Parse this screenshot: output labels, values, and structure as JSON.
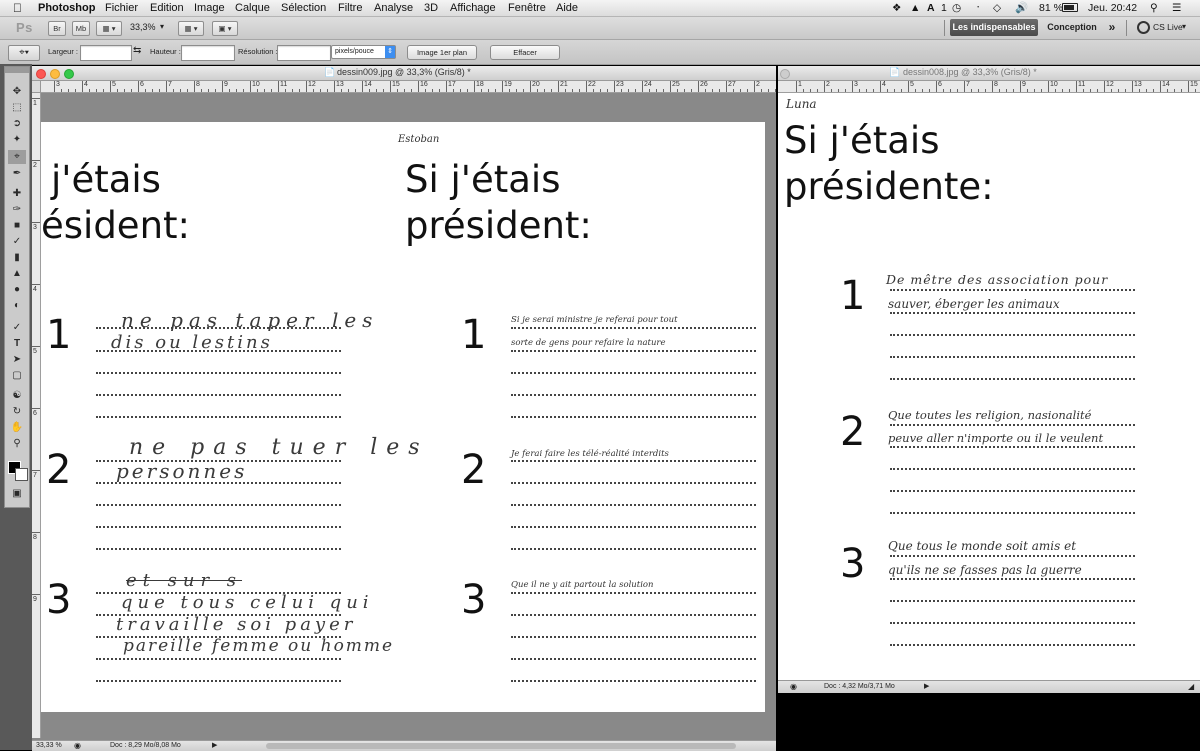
{
  "menubar": {
    "apple": "",
    "app_name": "Photoshop",
    "items": [
      "Fichier",
      "Edition",
      "Image",
      "Calque",
      "Sélection",
      "Filtre",
      "Analyse",
      "3D",
      "Affichage",
      "Fenêtre",
      "Aide"
    ],
    "status_icons": [
      "dropbox-icon",
      "drive-icon",
      "adobe-icon",
      "time-machine-icon",
      "bluetooth-icon",
      "wifi-icon",
      "volume-icon"
    ],
    "adobe_badge": "1",
    "battery": "81 %",
    "clock": "Jeu. 20:42"
  },
  "appbar": {
    "logo": "Ps",
    "bridge": "Br",
    "minibridge": "Mb",
    "zoom": "33,3%",
    "workspaces": [
      "Les indispensables",
      "Conception"
    ],
    "more": "»",
    "cs_live": "CS Live"
  },
  "options": {
    "width_label": "Largeur :",
    "width_value": "",
    "height_label": "Hauteur :",
    "height_value": "",
    "resolution_label": "Résolution :",
    "resolution_value": "",
    "units": "pixels/pouce",
    "front_image_button": "Image 1er plan",
    "clear_button": "Effacer"
  },
  "doc_left": {
    "title": "dessin009.jpg @ 33,3% (Gris/8) *",
    "ruler": [
      "3",
      "4",
      "5",
      "6",
      "7",
      "8",
      "9",
      "10",
      "11",
      "12",
      "13",
      "14",
      "15",
      "16",
      "17",
      "18",
      "19",
      "20",
      "21",
      "22",
      "23",
      "24",
      "25",
      "26",
      "27",
      "2"
    ],
    "vruler": [
      "1",
      "2",
      "3",
      "4",
      "5",
      "6",
      "7",
      "8",
      "9"
    ],
    "left_page": {
      "title_line1": "j'étais",
      "title_line2": "ésident:",
      "items": [
        {
          "number": "1",
          "lines": [
            "ne pas taper les",
            "dis ou lestins"
          ]
        },
        {
          "number": "2",
          "lines": [
            "ne pas tuer les",
            "personnes"
          ]
        },
        {
          "number": "3",
          "lines": [
            "et sur s",
            "que tous celui qui",
            "travaille soi payer",
            "pareille femme ou homme"
          ]
        }
      ]
    },
    "right_page": {
      "signature": "Estoban",
      "title_line1": "Si j'étais",
      "title_line2": "président:",
      "items": [
        {
          "number": "1",
          "lines": [
            "Si je serai ministre je referai pour tout",
            "sorte de gens pour refaire la nature"
          ]
        },
        {
          "number": "2",
          "lines": [
            "Je ferai faire les télé-réalité interdits"
          ]
        },
        {
          "number": "3",
          "lines": [
            "Que il ne y ait partout la solution"
          ]
        }
      ]
    },
    "status": {
      "zoom": "33,33 %",
      "doc": "Doc : 8,29 Mo/8,08 Mo"
    }
  },
  "doc_right": {
    "title": "dessin008.jpg @ 33,3% (Gris/8) *",
    "ruler": [
      "1",
      "2",
      "3",
      "4",
      "5",
      "6",
      "7",
      "8",
      "9",
      "10",
      "11",
      "12",
      "13",
      "14",
      "15"
    ],
    "page": {
      "signature": "Luna",
      "title_line1": "Si j'étais",
      "title_line2": "présidente:",
      "items": [
        {
          "number": "1",
          "lines": [
            "De mêtre des association pour",
            "sauver, éberger les animaux"
          ]
        },
        {
          "number": "2",
          "lines": [
            "Que toutes les religion, nasionalité",
            "peuve aller n'importe ou il le veulent"
          ]
        },
        {
          "number": "3",
          "lines": [
            "Que tous le monde soit amis et",
            "qu'ils ne se fasses pas la guerre"
          ]
        }
      ]
    },
    "status": {
      "doc": "Doc : 4,32 Mo/3,71 Mo"
    }
  }
}
